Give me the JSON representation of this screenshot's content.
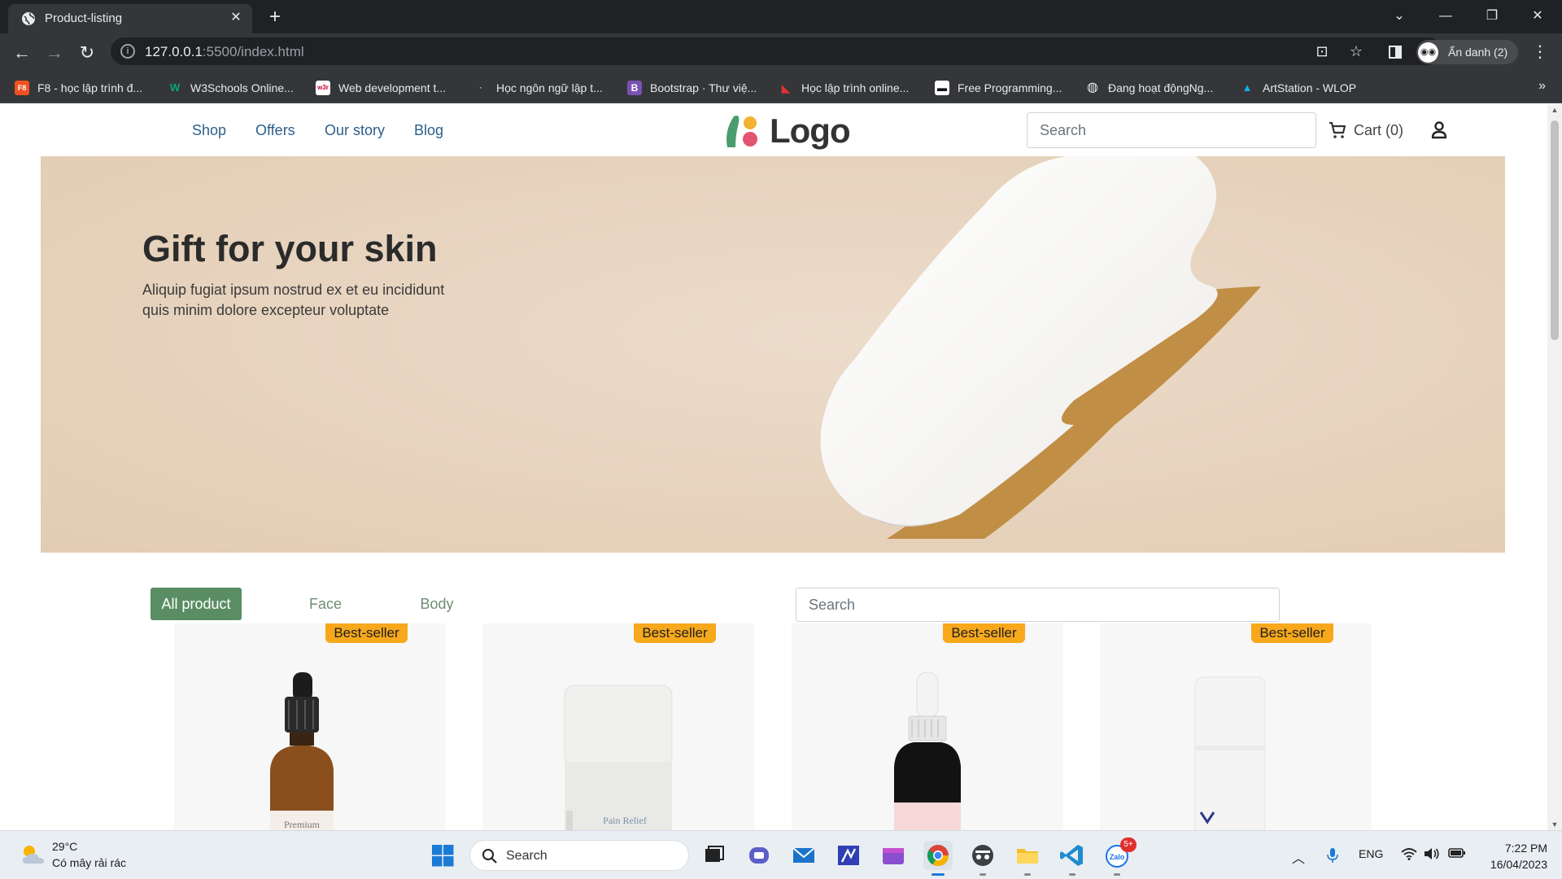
{
  "browser": {
    "tab_title": "Product-listing",
    "tab_close": "✕",
    "new_tab": "+",
    "url_host": "127.0.0.1",
    "url_rest": ":5500/index.html",
    "profile_label": "Ẩn danh (2)",
    "bookmarks": [
      {
        "label": "F8 - học lập trình đ...",
        "icon": "F8",
        "color": "#f05123"
      },
      {
        "label": "W3Schools Online...",
        "icon": "W",
        "color": "#04aa6d"
      },
      {
        "label": "Web development t...",
        "icon": "w3r",
        "color": "#ffffff"
      },
      {
        "label": "Học ngôn ngữ lập t...",
        "icon": "·",
        "color": "#35363a"
      },
      {
        "label": "Bootstrap · Thư việ...",
        "icon": "B",
        "color": "#7952b3"
      },
      {
        "label": "Học lập trình online...",
        "icon": "◣",
        "color": "#35363a"
      },
      {
        "label": "Free Programming...",
        "icon": "▬",
        "color": "#ffffff"
      },
      {
        "label": "Đang hoạt độngNg...",
        "icon": "◍",
        "color": "#35363a"
      },
      {
        "label": "ArtStation - WLOP",
        "icon": "▲",
        "color": "#35363a"
      }
    ],
    "bookmarks_more": "»"
  },
  "site": {
    "nav": [
      "Shop",
      "Offers",
      "Our story",
      "Blog"
    ],
    "logo_text": "Logo",
    "search_placeholder": "Search",
    "cart_label": "Cart (0)"
  },
  "hero": {
    "title": "Gift for your skin",
    "subtitle": "Aliquip fugiat ipsum nostrud ex et eu incididunt quis minim dolore excepteur voluptate"
  },
  "filters": {
    "items": [
      "All product",
      "Face",
      "Body"
    ],
    "active": "All product",
    "search_placeholder": "Search"
  },
  "products": [
    {
      "badge": "Best-seller",
      "label_text": "Premium"
    },
    {
      "badge": "Best-seller",
      "label_text": "Pain Relief"
    },
    {
      "badge": "Best-seller",
      "label_text": ""
    },
    {
      "badge": "Best-seller",
      "label_text": ""
    }
  ],
  "taskbar": {
    "weather_temp": "29°C",
    "weather_desc": "Có mây rải rác",
    "search_label": "Search",
    "lang": "ENG",
    "time": "7:22 PM",
    "date": "16/04/2023",
    "zalo_badge": "5+"
  },
  "colors": {
    "accent_green": "#5a8d64",
    "badge_orange": "#f7a81b",
    "nav_blue": "#2c5f8a",
    "hero_bg": "#e9d7c3"
  }
}
